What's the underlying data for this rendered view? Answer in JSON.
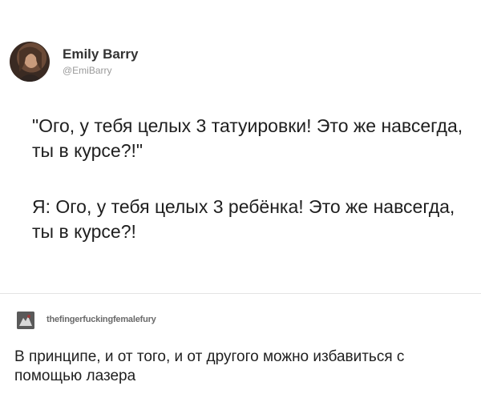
{
  "tweet": {
    "display_name": "Emily Barry",
    "handle": "@EmiBarry",
    "avatar_icon": "profile-photo",
    "paragraph_1": "\"Ого, у тебя целых 3 татуировки! Это же навсегда, ты в курсе?!\"",
    "paragraph_2": "Я: Ого, у тебя целых 3 ребёнка! Это же навсегда, ты в курсе?!"
  },
  "reply": {
    "username": "thefingerfuckingfemalefury",
    "avatar_icon": "user-avatar",
    "text": "В принципе, и от того, и от другого можно избавиться с помощью лазера"
  },
  "colors": {
    "background": "#ffffff",
    "name": "#333333",
    "handle": "#9a9a9a",
    "divider": "#e4e4e4"
  }
}
